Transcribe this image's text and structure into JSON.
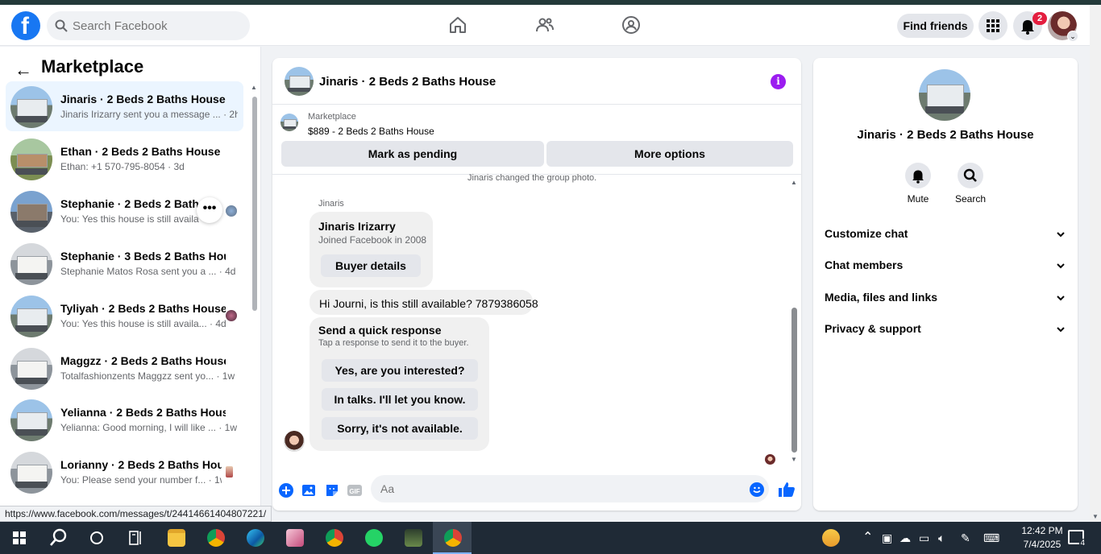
{
  "header": {
    "search_placeholder": "Search Facebook",
    "find_friends": "Find friends",
    "notification_count": "2"
  },
  "sidebar": {
    "title": "Marketplace",
    "conversations": [
      {
        "name": "Jinaris · 2 Beds 2 Baths House",
        "preview": "Jinaris Irizarry sent you a message ...",
        "time": "2h"
      },
      {
        "name": "Ethan · 2 Beds 2 Baths House",
        "preview": "Ethan: +1 570-795-8054",
        "time": "3d"
      },
      {
        "name": "Stephanie · 2 Beds 2 Baths H...",
        "preview": "You: Yes this house is still availa...",
        "time": ""
      },
      {
        "name": "Stephanie · 3 Beds 2 Baths House",
        "preview": "Stephanie Matos Rosa sent you a ...",
        "time": "4d"
      },
      {
        "name": "Tyliyah · 2 Beds 2 Baths House",
        "preview": "You: Yes this house is still availa...",
        "time": "4d"
      },
      {
        "name": "Maggzz · 2 Beds 2 Baths House",
        "preview": "Totalfashionzents Maggzz sent yo...",
        "time": "1w"
      },
      {
        "name": "Yelianna · 2 Beds 2 Baths House",
        "preview": "Yelianna: Good morning, I will like ...",
        "time": "1w"
      },
      {
        "name": "Lorianny · 2 Beds 2 Baths Hou...",
        "preview": "You: Please send your number f...",
        "time": "1w"
      }
    ],
    "more_options": "•••"
  },
  "status_url": "https://www.facebook.com/messages/t/24414661404807221/",
  "chat": {
    "title": "Jinaris · 2 Beds 2 Baths House",
    "marketplace_label": "Marketplace",
    "listing": "$889 - 2 Beds 2 Baths House",
    "mark_pending": "Mark as pending",
    "more_options": "More options",
    "system_message": "Jinaris changed the group photo.",
    "sender": "Jinaris",
    "profile_card": {
      "name": "Jinaris Irizarry",
      "joined": "Joined Facebook in 2008",
      "button": "Buyer details"
    },
    "message": "Hi Journi, is this still available? 7879386058",
    "quick_response": {
      "title": "Send a quick response",
      "subtitle": "Tap a response to send it to the buyer.",
      "options": [
        "Yes, are you interested?",
        "In talks. I'll let you know.",
        "Sorry, it's not available."
      ]
    },
    "composer_placeholder": "Aa"
  },
  "details": {
    "title": "Jinaris · 2 Beds 2 Baths House",
    "mute": "Mute",
    "search": "Search",
    "sections": [
      "Customize chat",
      "Chat members",
      "Media, files and links",
      "Privacy & support"
    ]
  },
  "taskbar": {
    "time": "12:42 PM",
    "date": "7/4/2025",
    "notification_count": "4"
  },
  "colors": {
    "brand_blue": "#1877f2",
    "messenger_blue": "#0866ff",
    "info_purple": "#9b1cf0",
    "badge_red": "#e41e3f"
  }
}
